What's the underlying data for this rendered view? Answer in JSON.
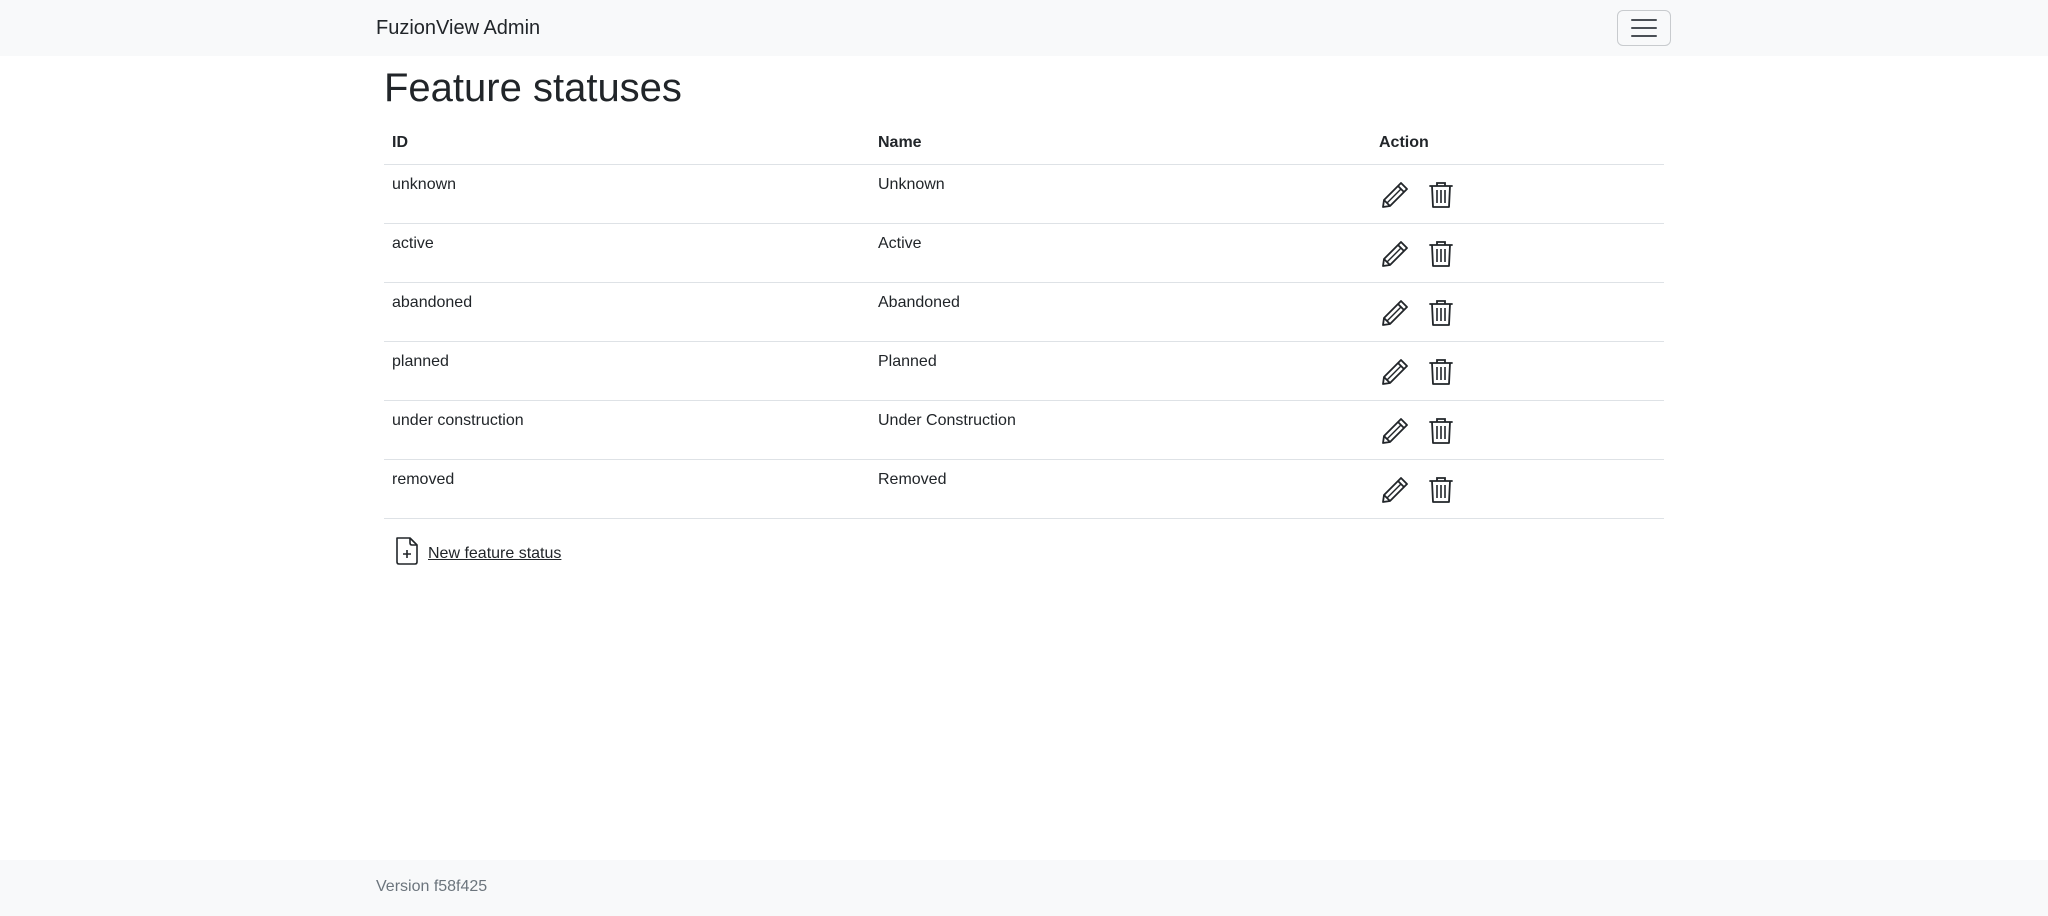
{
  "navbar": {
    "brand": "FuzionView Admin",
    "menu_icon": "hamburger-menu-icon"
  },
  "page": {
    "title": "Feature statuses"
  },
  "table": {
    "headers": [
      "ID",
      "Name",
      "Action"
    ],
    "rows": [
      {
        "id": "unknown",
        "name": "Unknown"
      },
      {
        "id": "active",
        "name": "Active"
      },
      {
        "id": "abandoned",
        "name": "Abandoned"
      },
      {
        "id": "planned",
        "name": "Planned"
      },
      {
        "id": "under construction",
        "name": "Under Construction"
      },
      {
        "id": "removed",
        "name": "Removed"
      }
    ],
    "action_icons": [
      "pencil-icon",
      "trash-icon"
    ]
  },
  "new_link": {
    "label": "New feature status",
    "icon": "file-plus-icon"
  },
  "footer": {
    "version": "Version f58f425"
  },
  "colors": {
    "navbar_bg": "#f8f9fa",
    "text": "#212529",
    "muted": "#6c757d",
    "border": "#dee2e6"
  }
}
